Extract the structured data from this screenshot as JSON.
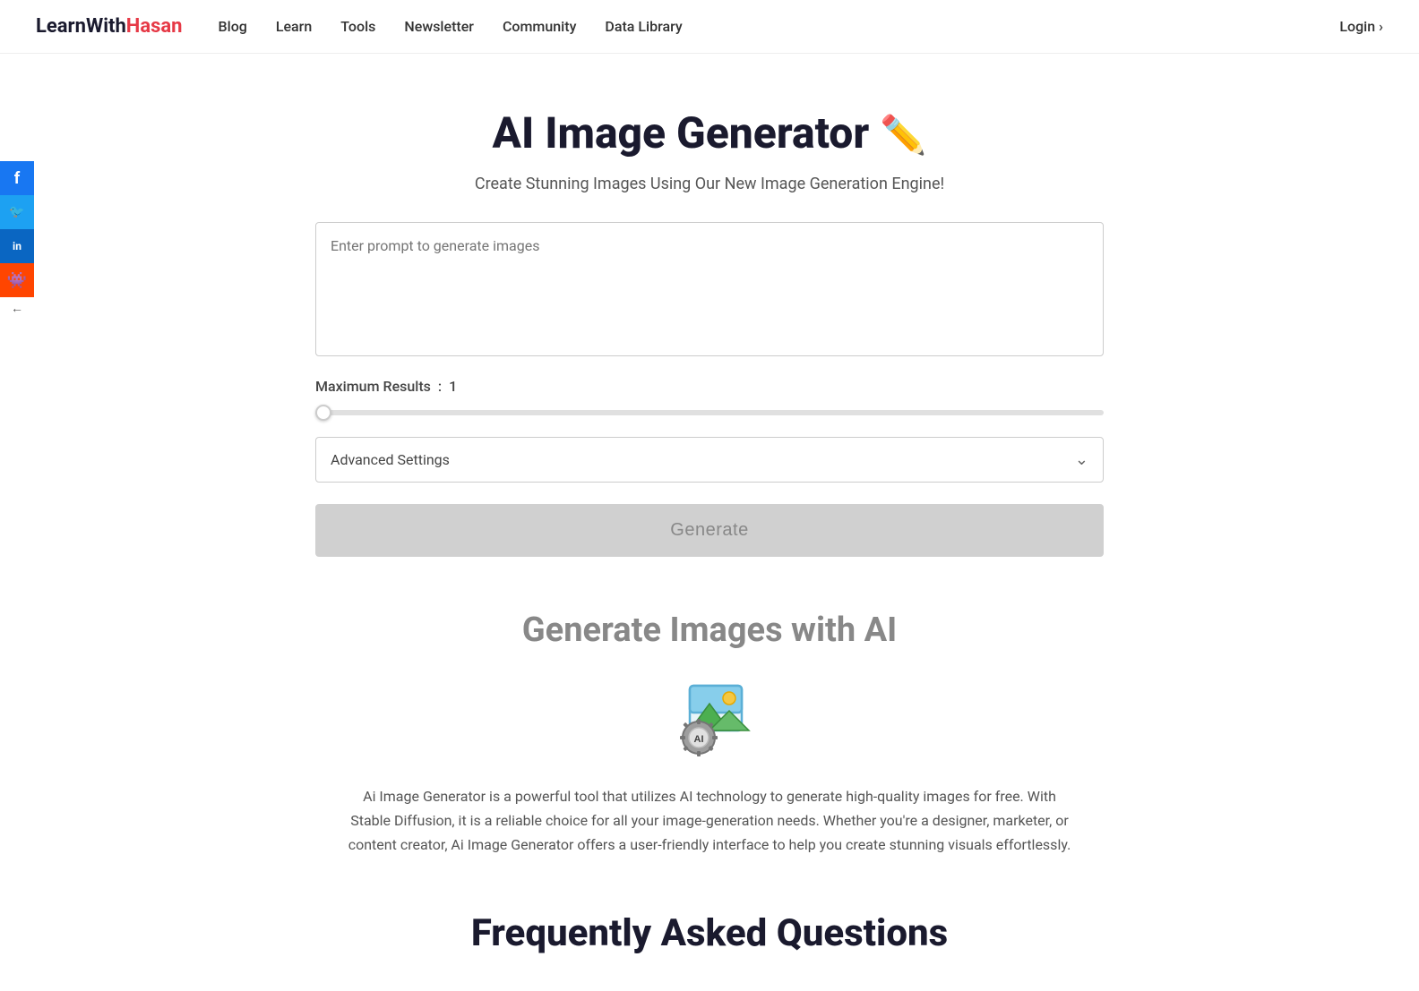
{
  "brand": {
    "learn": "Learn",
    "with": "With",
    "hasan": "Hasan",
    "full": "LearnWithHasan"
  },
  "navbar": {
    "links": [
      {
        "label": "Blog",
        "href": "#"
      },
      {
        "label": "Learn",
        "href": "#"
      },
      {
        "label": "Tools",
        "href": "#"
      },
      {
        "label": "Newsletter",
        "href": "#"
      },
      {
        "label": "Community",
        "href": "#"
      },
      {
        "label": "Data Library",
        "href": "#"
      }
    ],
    "login_label": "Login",
    "login_arrow": "›"
  },
  "social": {
    "facebook_letter": "f",
    "twitter_letter": "t",
    "linkedin_letter": "in",
    "reddit_letter": "r",
    "collapse_arrow": "←"
  },
  "hero": {
    "title": "AI Image Generator",
    "pencil_emoji": "🖊️",
    "subtitle": "Create Stunning Images Using Our New Image Generation Engine!"
  },
  "prompt": {
    "placeholder": "Enter prompt to generate images"
  },
  "settings": {
    "max_results_label": "Maximum Results",
    "colon": ":",
    "max_results_value": "1",
    "slider_min": 1,
    "slider_max": 10,
    "slider_value": 1,
    "advanced_label": "Advanced Settings"
  },
  "generate_button": {
    "label": "Generate"
  },
  "info_section": {
    "title": "Generate Images with AI",
    "description": "Ai Image Generator is a powerful tool that utilizes AI technology to generate high-quality images for free. With Stable Diffusion, it is a reliable choice for all your image-generation needs. Whether you're a designer, marketer, or content creator, Ai Image Generator offers a user-friendly interface to help you create stunning visuals effortlessly."
  },
  "faq": {
    "title": "Frequently Asked Questions"
  },
  "colors": {
    "brand_red": "#e63946",
    "brand_dark": "#1a1a2e",
    "facebook": "#1877f2",
    "twitter": "#1da1f2",
    "linkedin": "#0a66c2",
    "reddit": "#ff4500"
  }
}
